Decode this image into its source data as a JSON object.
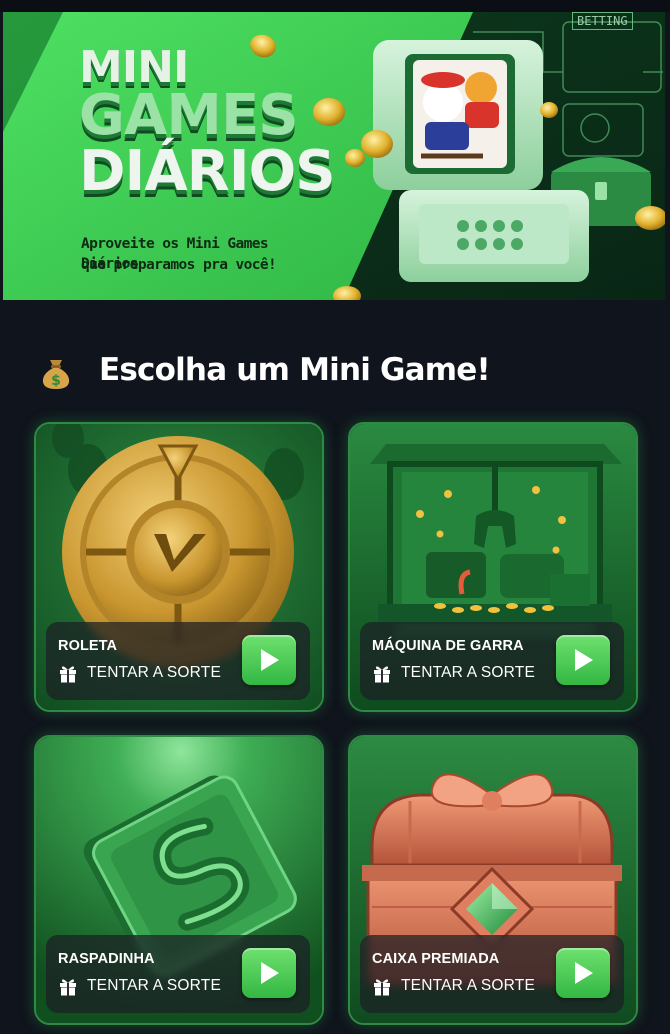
{
  "banner": {
    "title_line1": "MINI",
    "title_line2": "GAMES",
    "title_line3": "DIÁRIOS",
    "subtitle_line1": "Aproveite os Mini Games Diários",
    "subtitle_line2": "que preparamos pra você!",
    "machine_tag": "BETTING"
  },
  "section": {
    "icon": "money-bag-icon",
    "title": "Escolha um Mini Game!"
  },
  "games": [
    {
      "name": "ROLETA",
      "cta": "TENTAR A SORTE",
      "icon": "roulette-wheel"
    },
    {
      "name": "MÁQUINA DE GARRA",
      "cta": "TENTAR A SORTE",
      "icon": "claw-machine"
    },
    {
      "name": "RASPADINHA",
      "cta": "TENTAR A SORTE",
      "icon": "scratch-card"
    },
    {
      "name": "CAIXA PREMIADA",
      "cta": "TENTAR A SORTE",
      "icon": "treasure-chest"
    }
  ],
  "colors": {
    "background": "#10141c",
    "accent_green": "#3fc552",
    "card_border": "#2f8a44",
    "overlay": "#1c1e26"
  }
}
